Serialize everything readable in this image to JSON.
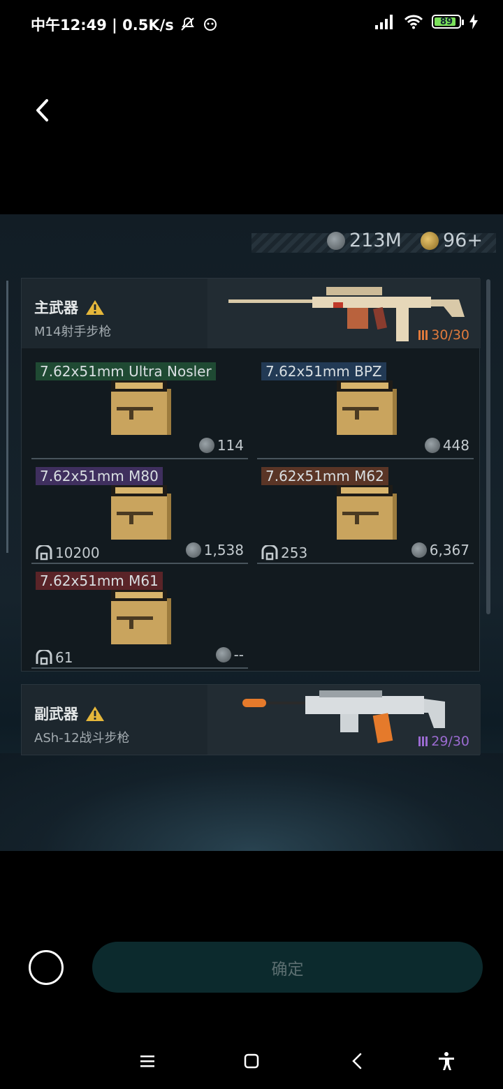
{
  "status_bar": {
    "time_text": "中午12:49 | 0.5K/s",
    "battery_level": "89",
    "battery_fraction": 0.89
  },
  "game": {
    "currency": {
      "silver": "213M",
      "gold": "96+"
    },
    "primary_weapon": {
      "category": "主武器",
      "name": "M14射手步枪",
      "ammo": "30/30",
      "ammo_color": "#e07a3c"
    },
    "ammo_options": [
      {
        "name": "7.62x51mm Ultra Nosler",
        "price": "114",
        "stock": "",
        "tag_color": "#1f4a33"
      },
      {
        "name": "7.62x51mm BPZ",
        "price": "448",
        "stock": "",
        "tag_color": "#223a55"
      },
      {
        "name": "7.62x51mm M80",
        "price": "1,538",
        "stock": "10200",
        "tag_color": "#3f2f5e"
      },
      {
        "name": "7.62x51mm M62",
        "price": "6,367",
        "stock": "253",
        "tag_color": "#5a3526"
      },
      {
        "name": "7.62x51mm M61",
        "price": "--",
        "stock": "61",
        "tag_color": "#5a2428"
      }
    ],
    "secondary_weapon": {
      "category": "副武器",
      "name": "ASh-12战斗步枪",
      "ammo": "29/30",
      "ammo_color": "#9b6bd1"
    }
  },
  "controls": {
    "confirm_label": "确定"
  }
}
